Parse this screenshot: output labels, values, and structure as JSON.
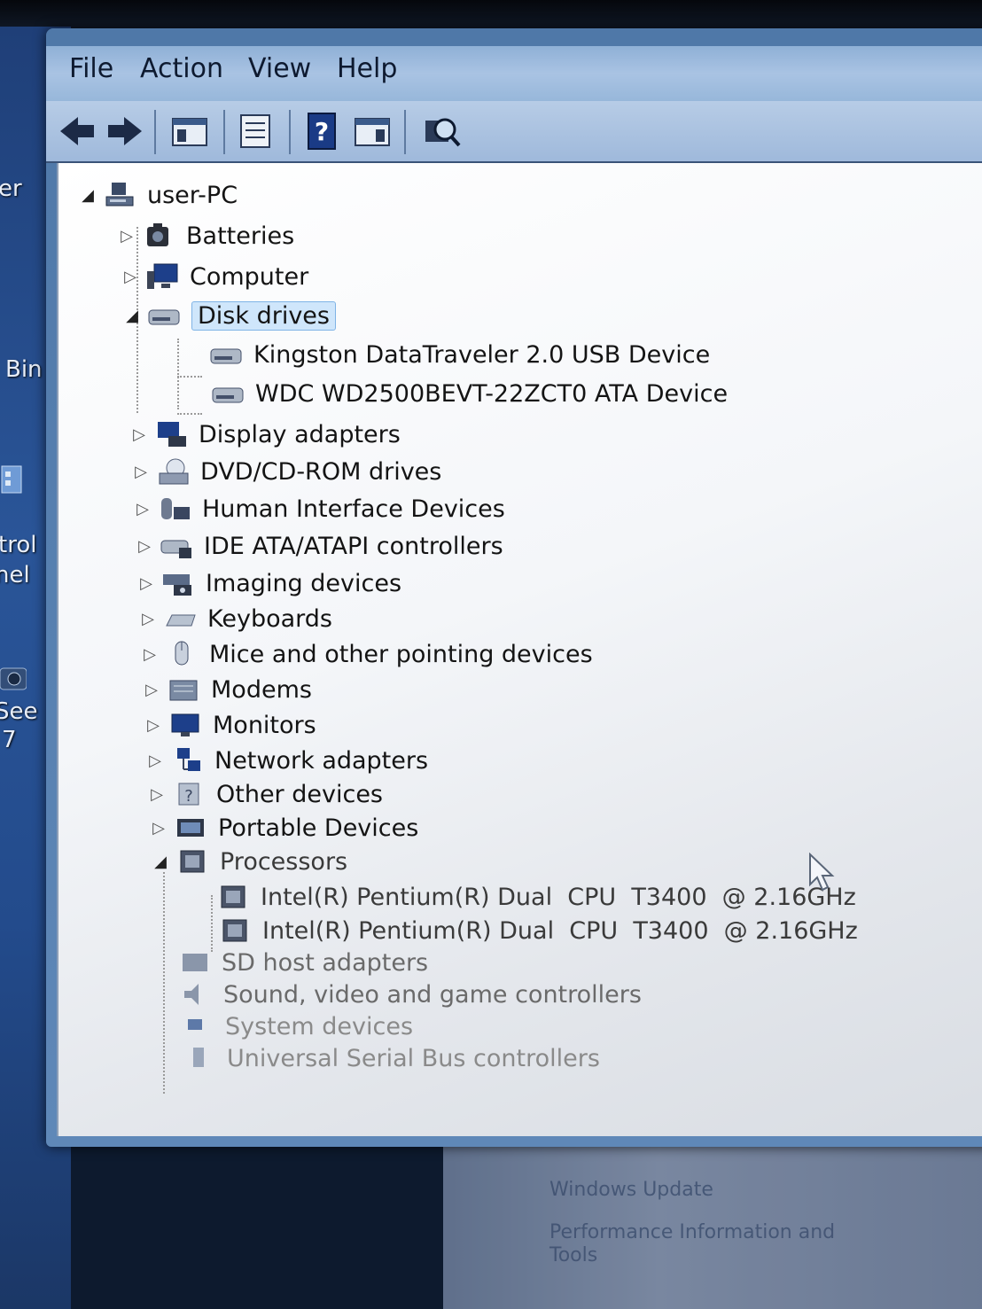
{
  "desktop": {
    "labels": [
      "er",
      "Bin",
      "trol",
      "nel",
      "See Pro",
      "7"
    ]
  },
  "menu": [
    "File",
    "Action",
    "View",
    "Help"
  ],
  "toolbar": {
    "buttons": [
      "back-arrow-icon",
      "forward-arrow-icon",
      "show-hide-tree-icon",
      "properties-icon",
      "help-icon",
      "action-pane-icon",
      "scan-hardware-icon"
    ]
  },
  "tree": {
    "root": "user-PC",
    "categories": [
      {
        "label": "Batteries",
        "expanded": false
      },
      {
        "label": "Computer",
        "expanded": false
      },
      {
        "label": "Disk drives",
        "expanded": true,
        "selected": true,
        "children": [
          "Kingston DataTraveler 2.0 USB Device",
          "WDC WD2500BEVT-22ZCT0 ATA Device"
        ]
      },
      {
        "label": "Display adapters",
        "expanded": false
      },
      {
        "label": "DVD/CD-ROM drives",
        "expanded": false
      },
      {
        "label": "Human Interface Devices",
        "expanded": false
      },
      {
        "label": "IDE ATA/ATAPI controllers",
        "expanded": false
      },
      {
        "label": "Imaging devices",
        "expanded": false
      },
      {
        "label": "Keyboards",
        "expanded": false
      },
      {
        "label": "Mice and other pointing devices",
        "expanded": false
      },
      {
        "label": "Modems",
        "expanded": false
      },
      {
        "label": "Monitors",
        "expanded": false
      },
      {
        "label": "Network adapters",
        "expanded": false
      },
      {
        "label": "Other devices",
        "expanded": false
      },
      {
        "label": "Portable Devices",
        "expanded": false
      },
      {
        "label": "Processors",
        "expanded": true,
        "children": [
          "Intel(R) Pentium(R) Dual  CPU  T3400  @ 2.16GHz",
          "Intel(R) Pentium(R) Dual  CPU  T3400  @ 2.16GHz"
        ]
      },
      {
        "label": "SD host adapters",
        "expanded": false
      },
      {
        "label": "Sound, video and game controllers",
        "expanded": false
      },
      {
        "label": "System devices",
        "expanded": false
      },
      {
        "label": "Universal Serial Bus controllers",
        "expanded": false
      }
    ]
  },
  "background_window": {
    "links": [
      "Windows Update",
      "Performance Information and Tools"
    ]
  }
}
